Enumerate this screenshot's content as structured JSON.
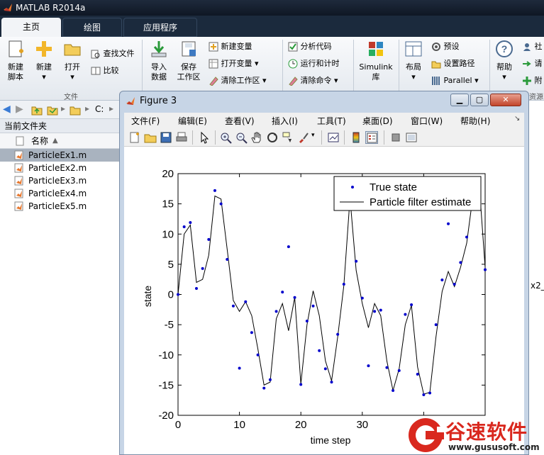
{
  "app": {
    "title": "MATLAB R2014a"
  },
  "tabs": [
    {
      "label": "主页",
      "active": true
    },
    {
      "label": "绘图"
    },
    {
      "label": "应用程序"
    }
  ],
  "ribbon": {
    "new_script": "新建\n脚本",
    "new": "新建",
    "open": "打开",
    "find_files": "查找文件",
    "compare": "比较",
    "file_group": "文件",
    "import_data": "导入\n数据",
    "save_workspace": "保存\n工作区",
    "new_variable": "新建变量",
    "open_variable": "打开变量",
    "clear_workspace": "清除工作区",
    "analyze_code": "分析代码",
    "run_and_time": "运行和计时",
    "clear_commands": "清除命令",
    "simulink": "Simulink\n库",
    "layout": "布局",
    "preferences": "预设",
    "set_path": "设置路径",
    "parallel": "Parallel",
    "help": "帮助",
    "community_partial": "社",
    "request_partial": "请",
    "addon_partial": "附",
    "resources_partial": "资源"
  },
  "pathbar": {
    "path_text": "C:"
  },
  "current_folder": {
    "title": "当前文件夹",
    "column_name": "名称",
    "files": [
      {
        "name": "ParticleEx1.m",
        "selected": true
      },
      {
        "name": "ParticleEx2.m"
      },
      {
        "name": "ParticleEx3.m"
      },
      {
        "name": "ParticleEx4.m"
      },
      {
        "name": "ParticleEx5.m"
      }
    ]
  },
  "side_text": "x2_",
  "figure": {
    "title": "Figure 3",
    "menu": [
      "文件(F)",
      "编辑(E)",
      "查看(V)",
      "插入(I)",
      "工具(T)",
      "桌面(D)",
      "窗口(W)",
      "帮助(H)"
    ]
  },
  "watermark": {
    "brand": "谷速软件",
    "url": "www.gususoft.com"
  },
  "chart_data": {
    "type": "line",
    "xlabel": "time step",
    "ylabel": "state",
    "xlim": [
      0,
      50
    ],
    "ylim": [
      -20,
      20
    ],
    "xticks": [
      0,
      10,
      20,
      30,
      40
    ],
    "yticks": [
      20,
      15,
      10,
      5,
      0,
      -5,
      -10,
      -15,
      -20
    ],
    "legend_position": "top-right",
    "grid": false,
    "series": [
      {
        "name": "True state",
        "style": "dots",
        "color": "#0000cc",
        "x": [
          0,
          1,
          2,
          3,
          4,
          5,
          6,
          7,
          8,
          9,
          10,
          11,
          12,
          13,
          14,
          15,
          16,
          17,
          18,
          19,
          20,
          21,
          22,
          23,
          24,
          25,
          26,
          27,
          28,
          29,
          30,
          31,
          32,
          33,
          34,
          35,
          36,
          37,
          38,
          39,
          40,
          41,
          42,
          43,
          44,
          45,
          46,
          47,
          48,
          49,
          50
        ],
        "y": [
          0,
          11.2,
          11.9,
          1,
          4.3,
          9.1,
          17.2,
          15,
          5.8,
          -1.9,
          -12.2,
          -1.2,
          -6.3,
          -10,
          -15.5,
          -14.1,
          -2.8,
          0.4,
          7.9,
          -0.5,
          -14.9,
          -4.4,
          -1.9,
          -9.3,
          -12.3,
          -14.5,
          -6.6,
          1.7,
          14.8,
          5.5,
          -0.6,
          -11.8,
          -2.8,
          -2.6,
          -12.1,
          -15.9,
          -12.6,
          -3.3,
          -1.7,
          -13.2,
          -16.6,
          -16.3,
          -5,
          2.4,
          11.7,
          1.7,
          5.3,
          9.5,
          15.5,
          18.5,
          4.1
        ]
      },
      {
        "name": "Particle filter estimate",
        "style": "line",
        "color": "#000000",
        "x": [
          0,
          1,
          2,
          3,
          4,
          5,
          6,
          7,
          8,
          9,
          10,
          11,
          12,
          13,
          14,
          15,
          16,
          17,
          18,
          19,
          20,
          21,
          22,
          23,
          24,
          25,
          26,
          27,
          28,
          29,
          30,
          31,
          32,
          33,
          34,
          35,
          36,
          37,
          38,
          39,
          40,
          41,
          42,
          43,
          44,
          45,
          46,
          47,
          48,
          49,
          50
        ],
        "y": [
          0,
          10,
          11.5,
          2,
          2.5,
          6.5,
          16.3,
          15.8,
          7.5,
          -1,
          -2.8,
          -1.2,
          -3.5,
          -9,
          -15,
          -14.5,
          -4,
          -1.5,
          -6,
          -0.5,
          -14.8,
          -5,
          0.6,
          -3.5,
          -11,
          -14.3,
          -7,
          1.5,
          16,
          4,
          -1.5,
          -5.5,
          -1.5,
          -3.5,
          -11,
          -15.9,
          -12.3,
          -5,
          -1.8,
          -12,
          -16.5,
          -16.2,
          -7,
          0.5,
          3.8,
          1.3,
          4.5,
          8.5,
          16.2,
          18.8,
          4.5
        ]
      }
    ]
  }
}
